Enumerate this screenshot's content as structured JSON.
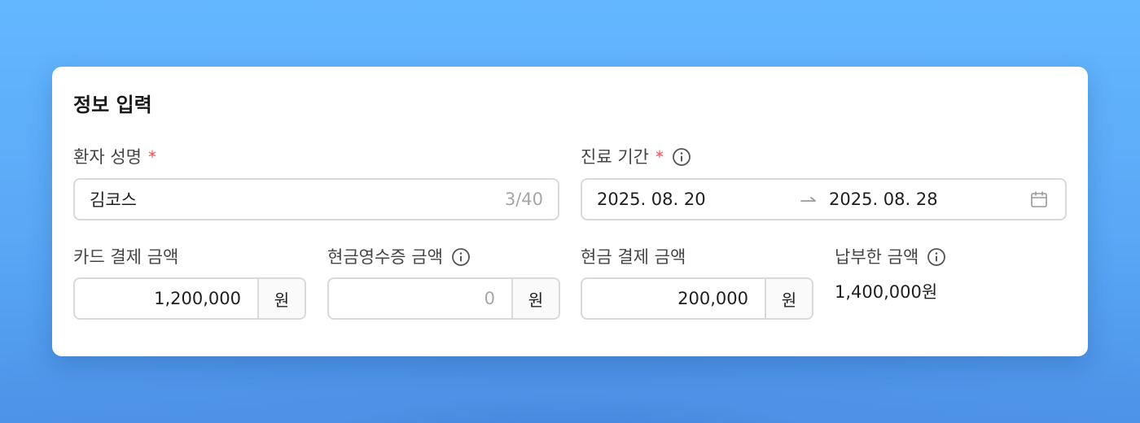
{
  "card": {
    "title": "정보 입력"
  },
  "patient_name": {
    "label": "환자 성명",
    "required_mark": "*",
    "value": "김코스",
    "counter": "3/40"
  },
  "treatment_period": {
    "label": "진료 기간",
    "required_mark": "*",
    "start_date": "2025. 08. 20",
    "end_date": "2025. 08. 28",
    "icons": [
      "info-icon",
      "arrow-right-icon",
      "calendar-icon"
    ]
  },
  "card_payment": {
    "label": "카드 결제 금액",
    "value": "1,200,000",
    "unit": "원"
  },
  "cash_receipt": {
    "label": "현금영수증 금액",
    "placeholder": "0",
    "unit": "원"
  },
  "cash_payment": {
    "label": "현금 결제 금액",
    "value": "200,000",
    "unit": "원"
  },
  "paid_amount": {
    "label": "납부한 금액",
    "value": "1,400,000원"
  },
  "colors": {
    "background": "#63b7ff",
    "required": "#ff4d4f",
    "border": "#d9d9d9",
    "placeholder": "#a6a6a6"
  }
}
